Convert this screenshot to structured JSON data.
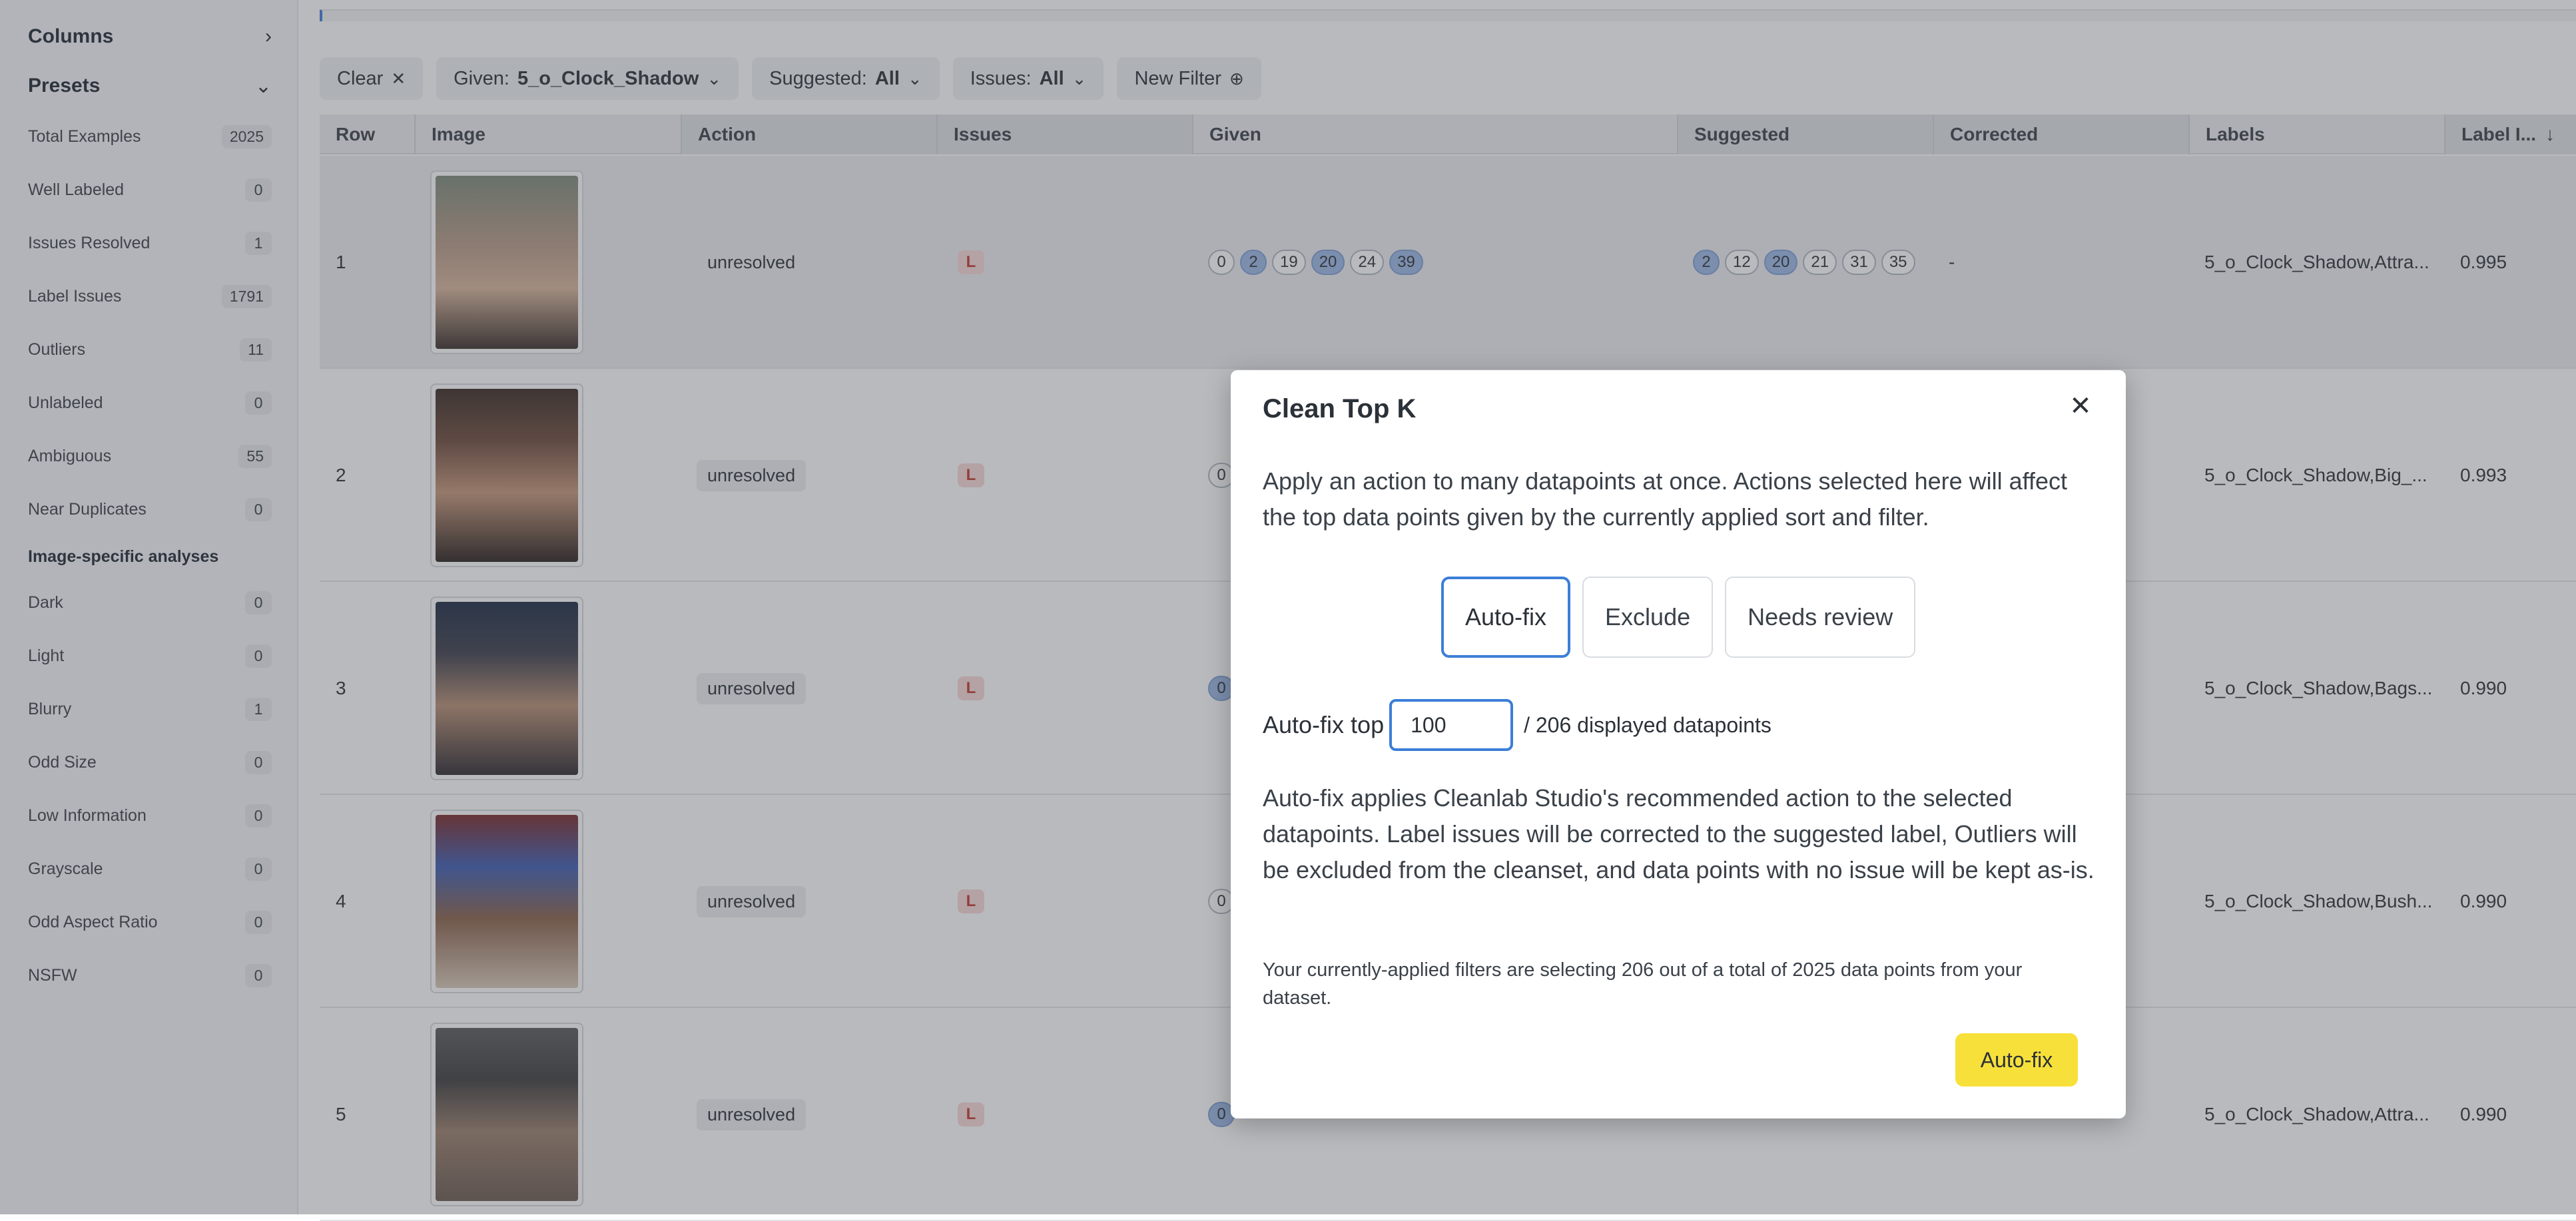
{
  "sidebar": {
    "columns_label": "Columns",
    "presets_label": "Presets",
    "presets": [
      {
        "label": "Total Examples",
        "count": "2025"
      },
      {
        "label": "Well Labeled",
        "count": "0"
      },
      {
        "label": "Issues Resolved",
        "count": "1"
      },
      {
        "label": "Label Issues",
        "count": "1791"
      },
      {
        "label": "Outliers",
        "count": "11"
      },
      {
        "label": "Unlabeled",
        "count": "0"
      },
      {
        "label": "Ambiguous",
        "count": "55"
      },
      {
        "label": "Near Duplicates",
        "count": "0"
      }
    ],
    "image_section_label": "Image-specific analyses",
    "image_analyses": [
      {
        "label": "Dark",
        "count": "0"
      },
      {
        "label": "Light",
        "count": "0"
      },
      {
        "label": "Blurry",
        "count": "1"
      },
      {
        "label": "Odd Size",
        "count": "0"
      },
      {
        "label": "Low Information",
        "count": "0"
      },
      {
        "label": "Grayscale",
        "count": "0"
      },
      {
        "label": "Odd Aspect Ratio",
        "count": "0"
      },
      {
        "label": "NSFW",
        "count": "0"
      }
    ]
  },
  "filters": {
    "clear_label": "Clear",
    "given_label": "Given:",
    "given_value": "5_o_Clock_Shadow",
    "suggested_label": "Suggested:",
    "suggested_value": "All",
    "issues_label": "Issues:",
    "issues_value": "All",
    "new_filter_label": "New Filter"
  },
  "table": {
    "headers": {
      "row": "Row",
      "image": "Image",
      "action": "Action",
      "issues": "Issues",
      "given": "Given",
      "suggested": "Suggested",
      "corrected": "Corrected",
      "labels": "Labels",
      "label_issue": "Label I..."
    },
    "rows": [
      {
        "row": "1",
        "action": "unresolved",
        "issue": "L",
        "given": [
          "0",
          "2",
          "19",
          "20",
          "24",
          "39"
        ],
        "suggested": [
          "2",
          "12",
          "20",
          "21",
          "31",
          "35"
        ],
        "corrected": "-",
        "labels": "5_o_Clock_Shadow,Attra...",
        "score": "0.995"
      },
      {
        "row": "2",
        "action": "unresolved",
        "issue": "L",
        "given": [
          "0"
        ],
        "suggested": [],
        "corrected": "",
        "labels": "5_o_Clock_Shadow,Big_...",
        "score": "0.993"
      },
      {
        "row": "3",
        "action": "unresolved",
        "issue": "L",
        "given": [
          "0"
        ],
        "suggested": [],
        "corrected": "",
        "labels": "5_o_Clock_Shadow,Bags...",
        "score": "0.990"
      },
      {
        "row": "4",
        "action": "unresolved",
        "issue": "L",
        "given": [
          "0"
        ],
        "suggested": [],
        "corrected": "",
        "labels": "5_o_Clock_Shadow,Bush...",
        "score": "0.990"
      },
      {
        "row": "5",
        "action": "unresolved",
        "issue": "L",
        "given": [
          "0"
        ],
        "suggested": [],
        "corrected": "",
        "labels": "5_o_Clock_Shadow,Attra...",
        "score": "0.990"
      }
    ]
  },
  "modal": {
    "title": "Clean Top K",
    "description": "Apply an action to many datapoints at once. Actions selected here will affect the top data points given by the currently applied sort and filter.",
    "options": [
      "Auto-fix",
      "Exclude",
      "Needs review"
    ],
    "selected_option": "Auto-fix",
    "input_label": "Auto-fix top",
    "input_value": "100",
    "input_suffix": "/ 206 displayed datapoints",
    "info": "Auto-fix applies Cleanlab Studio's recommended action to the selected datapoints. Label issues will be corrected to the suggested label, Outliers will be excluded from the cleanset, and data points with no issue will be kept as-is.",
    "note": "Your currently-applied filters are selecting 206 out of a total of 2025 data points from your dataset.",
    "confirm_label": "Auto-fix"
  },
  "colors": {
    "accent": "#3c7ed8",
    "confirm_button": "#f7e03a",
    "issue_badge": "#c0392b",
    "tag_highlight": "#9cb8e6"
  }
}
